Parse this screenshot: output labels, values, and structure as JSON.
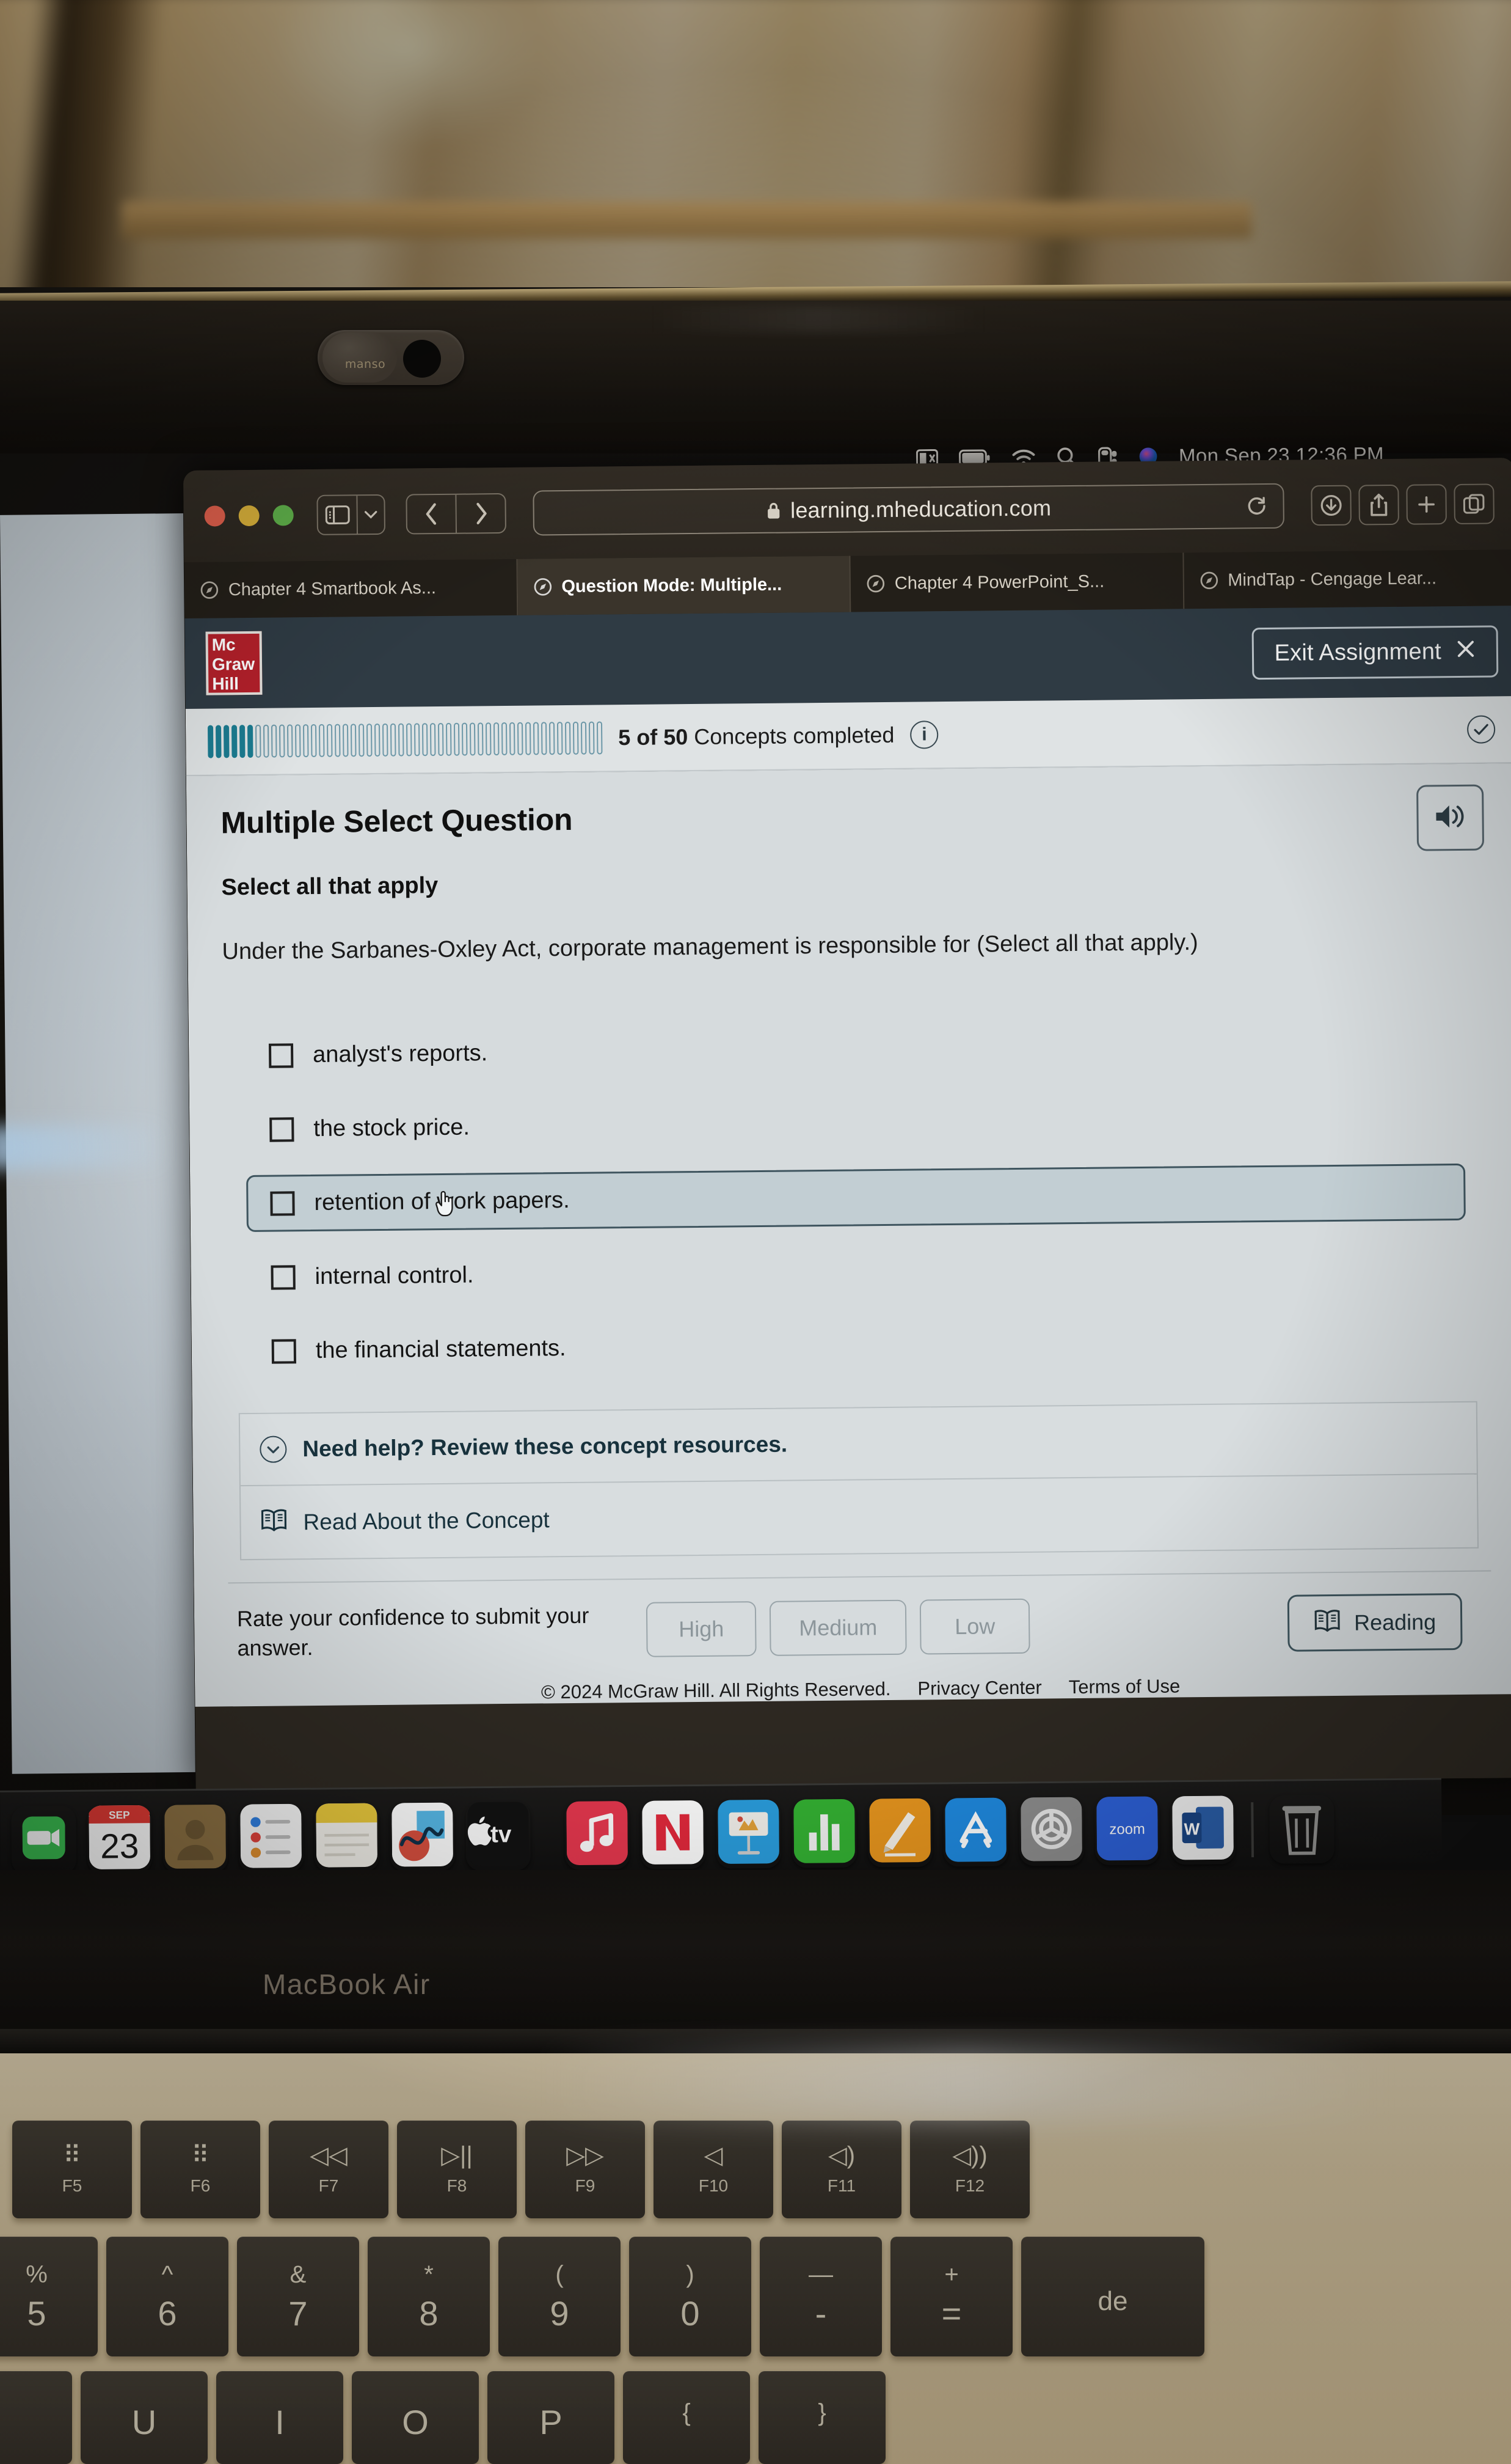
{
  "menubar": {
    "icons": [
      "screen-record-icon",
      "battery-icon",
      "wifi-icon",
      "spotlight-search-icon",
      "control-center-icon",
      "siri-icon"
    ],
    "datetime": "Mon Sep 23  12:36 PM"
  },
  "browser": {
    "url": "learning.mheducation.com",
    "toolbar": {
      "sidebar_icon": "sidebar-icon",
      "sidebar_chevron": "chevron-down-icon",
      "back_icon": "back-chevron-icon",
      "forward_icon": "forward-chevron-icon",
      "lock_icon": "lock-icon",
      "reload_icon": "reload-icon",
      "downloads_icon": "downloads-icon",
      "share_icon": "share-icon",
      "new_tab_icon": "plus-icon",
      "tab_overview_icon": "tab-overview-icon"
    },
    "tabs": [
      {
        "label": "Chapter 4 Smartbook As...",
        "active": false
      },
      {
        "label": "Question Mode: Multiple...",
        "active": true
      },
      {
        "label": "Chapter 4 PowerPoint_S...",
        "active": false
      },
      {
        "label": "MindTap - Cengage Lear...",
        "active": false
      }
    ]
  },
  "app_header": {
    "logo_lines": [
      "Mc",
      "Graw",
      "Hill"
    ],
    "exit_label": "Exit Assignment",
    "exit_close_icon": "close-x-icon"
  },
  "progress": {
    "completed": 5,
    "total": 50,
    "count_label": "5 of 50",
    "suffix_label": "Concepts completed",
    "info_icon": "info-icon",
    "check_icon": "check-circle-icon",
    "segments_total": 50,
    "segments_filled": 6,
    "fill_color": "#1b7b90"
  },
  "question": {
    "type_title": "Multiple Select Question",
    "instruction": "Select all that apply",
    "stem": "Under the Sarbanes-Oxley Act, corporate management is responsible for (Select all that apply.)",
    "audio_icon": "speaker-icon",
    "options": [
      {
        "label": "analyst's reports.",
        "checked": false,
        "hovered": false
      },
      {
        "label": "the stock price.",
        "checked": false,
        "hovered": false
      },
      {
        "label": "retention of work papers.",
        "checked": false,
        "hovered": true
      },
      {
        "label": "internal control.",
        "checked": false,
        "hovered": false
      },
      {
        "label": "the financial statements.",
        "checked": false,
        "hovered": false
      }
    ]
  },
  "help": {
    "header_label": "Need help? Review these concept resources.",
    "chevron_icon": "chevron-down-circle-icon",
    "resource_label": "Read About the Concept",
    "resource_icon": "book-icon"
  },
  "confidence": {
    "prompt": "Rate your confidence to submit your answer.",
    "buttons": [
      "High",
      "Medium",
      "Low"
    ],
    "reading_label": "Reading",
    "reading_icon": "book-icon"
  },
  "footer": {
    "copyright": "© 2024 McGraw Hill. All Rights Reserved.",
    "links": [
      "Privacy Center",
      "Terms of Use"
    ]
  },
  "dock": {
    "apps": [
      {
        "name": "facetime",
        "icon": "facetime-icon",
        "color": "#3bbf52"
      },
      {
        "name": "calendar",
        "icon": "calendar-icon",
        "color": "#ffffff",
        "month": "SEP",
        "day": "23"
      },
      {
        "name": "contacts",
        "icon": "contacts-icon",
        "color": "#8a6f42"
      },
      {
        "name": "reminders",
        "icon": "reminders-icon",
        "color": "#f3f3f3"
      },
      {
        "name": "notes",
        "icon": "notes-icon",
        "color": "#f4e6a8"
      },
      {
        "name": "freeform",
        "icon": "freeform-icon",
        "color": "#ffffff"
      },
      {
        "name": "apple-tv",
        "icon": "apple-tv-icon",
        "color": "#101010",
        "label": "tv"
      },
      {
        "name": "music",
        "icon": "music-note-icon",
        "color": "#e8384f"
      },
      {
        "name": "news",
        "icon": "news-icon",
        "color": "#ffffff"
      },
      {
        "name": "keynote",
        "icon": "keynote-icon",
        "color": "#2a9ede"
      },
      {
        "name": "numbers",
        "icon": "numbers-icon",
        "color": "#34b233"
      },
      {
        "name": "pages",
        "icon": "pages-icon",
        "color": "#e8961e"
      },
      {
        "name": "app-store",
        "icon": "app-store-icon",
        "color": "#1f8ae0"
      },
      {
        "name": "system-settings",
        "icon": "gear-icon",
        "color": "#8e8e8e"
      },
      {
        "name": "zoom",
        "icon": "zoom-icon",
        "color": "#2d61d8",
        "label": "zoom"
      },
      {
        "name": "microsoft-word",
        "icon": "word-icon",
        "color": "#f0f0f0",
        "label": "W"
      },
      {
        "name": "trash",
        "icon": "trash-icon",
        "color": "#4a4a48"
      }
    ]
  },
  "laptop": {
    "model_label": "MacBook Air",
    "webcam_cover_brand": "manso"
  },
  "keyboard": {
    "function_row": [
      {
        "glyph": "⠿",
        "sub": "F5",
        "name": "keyboard-brightness-down"
      },
      {
        "glyph": "⠿",
        "sub": "F6",
        "name": "keyboard-brightness-up"
      },
      {
        "glyph": "◁◁",
        "sub": "F7",
        "name": "rewind"
      },
      {
        "glyph": "▷||",
        "sub": "F8",
        "name": "play-pause"
      },
      {
        "glyph": "▷▷",
        "sub": "F9",
        "name": "fast-forward"
      },
      {
        "glyph": "◁",
        "sub": "F10",
        "name": "mute"
      },
      {
        "glyph": "◁)",
        "sub": "F11",
        "name": "volume-down"
      },
      {
        "glyph": "◁))",
        "sub": "F12",
        "name": "volume-up"
      }
    ],
    "number_row": [
      {
        "top": "%",
        "bot": "5"
      },
      {
        "top": "^",
        "bot": "6"
      },
      {
        "top": "&",
        "bot": "7"
      },
      {
        "top": "*",
        "bot": "8"
      },
      {
        "top": "(",
        "bot": "9"
      },
      {
        "top": ")",
        "bot": "0"
      },
      {
        "top": "—",
        "bot": "-"
      },
      {
        "top": "+",
        "bot": "="
      },
      {
        "top": "",
        "bot": "de"
      }
    ],
    "letter_row": [
      {
        "top": "",
        "bot": ""
      },
      {
        "top": "",
        "bot": "U"
      },
      {
        "top": "",
        "bot": "I"
      },
      {
        "top": "",
        "bot": "O"
      },
      {
        "top": "",
        "bot": "P"
      },
      {
        "top": "{",
        "bot": ""
      },
      {
        "top": "}",
        "bot": ""
      }
    ]
  }
}
